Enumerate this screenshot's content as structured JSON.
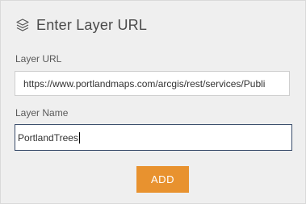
{
  "header": {
    "icon": "layers-icon",
    "title": "Enter Layer URL"
  },
  "form": {
    "url_label": "Layer URL",
    "url_value": "https://www.portlandmaps.com/arcgis/rest/services/Publi",
    "name_label": "Layer Name",
    "name_value": "PortlandTrees"
  },
  "actions": {
    "add_label": "ADD"
  },
  "colors": {
    "panel_bg": "#efefef",
    "accent": "#e8922f",
    "focus_border": "#3a4d6b"
  }
}
